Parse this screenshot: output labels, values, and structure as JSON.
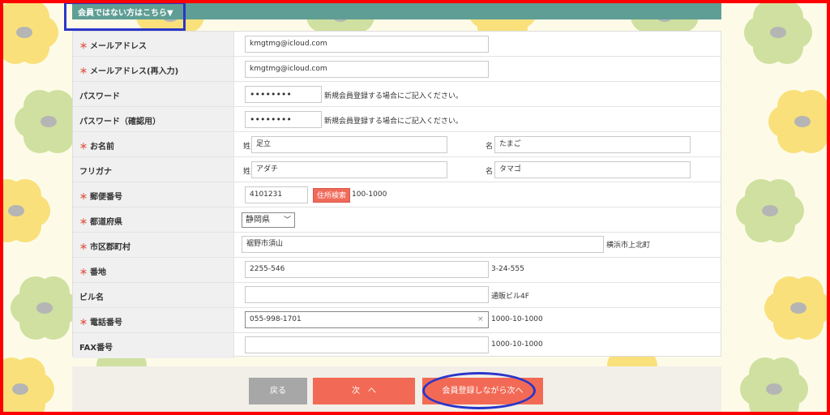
{
  "header": {
    "title": "会員ではない方はこちら▼"
  },
  "required_mark": "＊",
  "fields": {
    "email": {
      "label": "メールアドレス",
      "value": "kmgtmg@icloud.com"
    },
    "email_confirm": {
      "label": "メールアドレス(再入力)",
      "value": "kmgtmg@icloud.com"
    },
    "password": {
      "label": "パスワード",
      "value": "••••••••",
      "note": "新規会員登録する場合にご記入ください。"
    },
    "password_confirm": {
      "label": "パスワード（確認用）",
      "value": "••••••••",
      "note": "新規会員登録する場合にご記入ください。"
    },
    "name": {
      "label": "お名前",
      "sei_prefix": "姓",
      "sei_value": "足立",
      "mei_prefix": "名",
      "mei_value": "たまご"
    },
    "furigana": {
      "label": "フリガナ",
      "sei_prefix": "姓",
      "sei_value": "アダチ",
      "mei_prefix": "名",
      "mei_value": "タマゴ"
    },
    "zip": {
      "label": "郵便番号",
      "value": "4101231",
      "search_button": "住所検索",
      "note": "100-1000"
    },
    "prefecture": {
      "label": "都道府県",
      "value": "静岡県"
    },
    "city": {
      "label": "市区郡町村",
      "value": "裾野市須山",
      "note": "横浜市上北町"
    },
    "address": {
      "label": "番地",
      "value": "2255-546",
      "note": "3-24-555"
    },
    "building": {
      "label": "ビル名",
      "value": "",
      "note": "通販ビル4F"
    },
    "phone": {
      "label": "電話番号",
      "value": "055-998-1701",
      "clear": "×",
      "note": "1000-10-1000"
    },
    "fax": {
      "label": "FAX番号",
      "value": "",
      "note": "1000-10-1000"
    }
  },
  "buttons": {
    "back": "戻る",
    "next": "次　へ",
    "register": "会員登録しながら次へ"
  },
  "colors": {
    "header_bg": "#5f9e94",
    "accent_button": "#f26a55",
    "back_button": "#a7a7a7",
    "frame": "#ff0000",
    "highlight": "#2b35c9"
  }
}
